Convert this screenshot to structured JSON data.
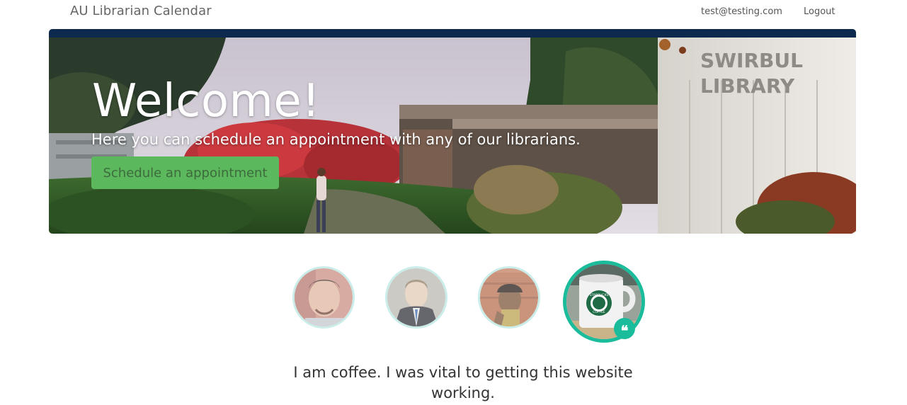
{
  "navbar": {
    "brand": "AU Librarian Calendar",
    "user_email": "test@testing.com",
    "logout_label": "Logout"
  },
  "hero": {
    "title": "Welcome!",
    "subtitle": "Here you can schedule an appointment with any of our librarians.",
    "cta_label": "Schedule an appointment",
    "background_sign": [
      "SWIRBUL",
      "LIBRARY"
    ]
  },
  "testimonials": {
    "avatars": [
      {
        "name": "team-member-1"
      },
      {
        "name": "team-member-2"
      },
      {
        "name": "team-member-3"
      },
      {
        "name": "coffee-mug",
        "active": true
      }
    ],
    "mug_logo_text": [
      "STARBUCKS",
      "COFFEE"
    ],
    "active_quote": "I am coffee. I was vital to getting this website working."
  },
  "colors": {
    "accent": "#1abc9c",
    "cta": "#5cb85c",
    "hero_topbar": "#0d2a4e"
  }
}
